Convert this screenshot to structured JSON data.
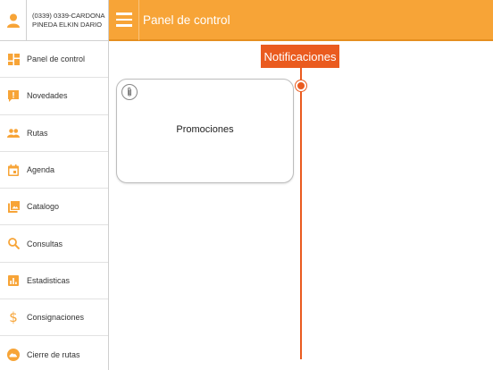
{
  "user": {
    "line1": "(0339) 0339-CARDONA",
    "line2": "PINEDA ELKIN DARIO"
  },
  "header": {
    "title": "Panel de control"
  },
  "sidebar": {
    "items": [
      {
        "label": "Panel de control",
        "icon": "dashboard-icon"
      },
      {
        "label": "Novedades",
        "icon": "alert-icon"
      },
      {
        "label": "Rutas",
        "icon": "people-icon"
      },
      {
        "label": "Agenda",
        "icon": "calendar-icon"
      },
      {
        "label": "Catalogo",
        "icon": "catalog-icon"
      },
      {
        "label": "Consultas",
        "icon": "search-icon"
      },
      {
        "label": "Estadisticas",
        "icon": "stats-icon"
      },
      {
        "label": "Consignaciones",
        "icon": "dollar-icon"
      },
      {
        "label": "Cierre de rutas",
        "icon": "cloud-icon"
      }
    ]
  },
  "main": {
    "notifications_label": "Notificaciones",
    "card": {
      "title": "Promociones",
      "icon": "paperclip-icon"
    }
  },
  "colors": {
    "accent": "#f7a437",
    "notification": "#ea5b1f",
    "icon": "#f7a437"
  }
}
